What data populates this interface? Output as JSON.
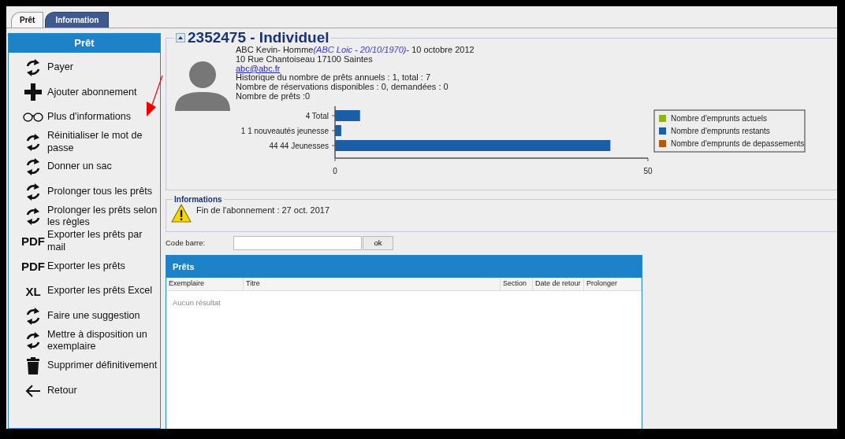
{
  "tabs": [
    {
      "label": "Prêt",
      "selected": true
    },
    {
      "label": "Information",
      "selected": false
    }
  ],
  "sidebar": {
    "title": "Prêt",
    "items": [
      {
        "kind": "refresh",
        "label": "Payer"
      },
      {
        "kind": "plus",
        "label": "Ajouter abonnement"
      },
      {
        "kind": "glasses",
        "label": "Plus d'informations"
      },
      {
        "kind": "refresh",
        "label": "Réinitialiser le mot de passe"
      },
      {
        "kind": "refresh",
        "label": "Donner un sac"
      },
      {
        "kind": "refresh",
        "label": "Prolonger tous les prêts"
      },
      {
        "kind": "refresh",
        "label": "Prolonger les prêts selon les règles"
      },
      {
        "kind": "text",
        "icon_text": "PDF",
        "label": "Exporter les prêts par mail"
      },
      {
        "kind": "text",
        "icon_text": "PDF",
        "label": "Exporter les prêts"
      },
      {
        "kind": "text",
        "icon_text": "XL",
        "label": "Exporter les prêts Excel"
      },
      {
        "kind": "refresh",
        "label": "Faire une suggestion"
      },
      {
        "kind": "refresh",
        "label": "Mettre à disposition un exemplaire"
      },
      {
        "kind": "trash",
        "label": "Supprimer définitivement"
      },
      {
        "kind": "back",
        "label": "Retour"
      }
    ]
  },
  "patron": {
    "title": "2352475 - Individuel",
    "name": "ABC Kevin- Homme",
    "guardian": "(ABC Loic - 20/10/1970)",
    "date": "- 10 octobre 2012",
    "address": "10 Rue Chantoiseau 17100 Saintes",
    "email": "abc@abc.fr",
    "lines": [
      "Historique du nombre de prêts annuels : 1, total : 7",
      "Nombre de réservations disponibles : 0, demandées : 0",
      "Nombre de prêts :0"
    ],
    "chart_data": {
      "type": "bar",
      "orientation": "horizontal",
      "stacked": true,
      "categories": [
        "4 Total",
        "1 1 nouveautés jeunesse",
        "44 44 Jeunesses"
      ],
      "series": [
        {
          "name": "Nombre d'emprunts actuels",
          "color": "#8fb31b",
          "values": [
            0,
            0,
            0
          ]
        },
        {
          "name": "Nombre d'emprunts restants",
          "color": "#1c5ea6",
          "values": [
            4,
            1,
            44
          ]
        },
        {
          "name": "Nombre d'emprunts de depassements",
          "color": "#b35a12",
          "values": [
            0,
            0,
            0
          ]
        }
      ],
      "xlim": [
        0,
        50
      ],
      "xticks": [
        0,
        50
      ]
    }
  },
  "informations": {
    "title": "Informations",
    "message": "Fin de l'abonnement : 27 oct. 2017"
  },
  "barcode": {
    "label": "Code barre:",
    "button": "ok"
  },
  "loans": {
    "title": "Prêts",
    "columns": [
      "Exemplaire",
      "Titre",
      "Section",
      "Date de retour",
      "Prolonger"
    ],
    "empty": "Aucun résultat"
  }
}
